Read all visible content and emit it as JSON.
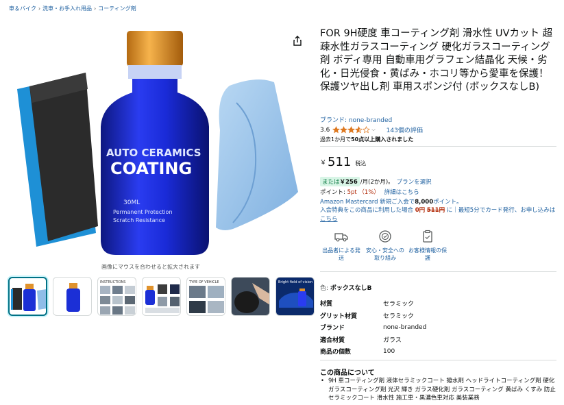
{
  "breadcrumb": [
    "車＆バイク",
    "洗車・お手入れ用品",
    "コーティング剤"
  ],
  "gallery": {
    "bottle_label": [
      "AUTO CERAMICS",
      "COATING",
      "30ML",
      "Permanent Protection",
      "Scratch Resistance"
    ],
    "hover_note": "画像にマウスを合わせると拡大されます",
    "thumb_text": {
      "instructions": "INSTRUCTIONS",
      "type_of_vehicle": "TYPE OF VEHICLE",
      "bright_field": "Bright field of vision"
    }
  },
  "product": {
    "title": "FOR 9H硬度 車コーティング剤 滑水性 UVカット 超疎水性ガラスコーティング 硬化ガラスコーティング剤 ボディ専用 自動車用グラフェン結晶化 天候・劣化・日光侵食・黄ばみ・ホコリ等から愛車を保護！ 保護ツヤ出し剤 車用スポンジ付 (ボックスなしB)",
    "brand": "ブランド: none-branded",
    "rating": "3.6",
    "rating_value": 3.6,
    "review_count": "143個の評価",
    "bought_prefix": "過去1か月で",
    "bought_bold": "50点以上購入されました"
  },
  "price": {
    "currency": "￥",
    "amount": "511",
    "tax": "税込"
  },
  "installment": {
    "prefix": "または",
    "amount": "￥256",
    "rest": "/月(2か月)。",
    "plan_link": "プランを選択"
  },
  "points": {
    "label": "ポイント: ",
    "value": "5pt （1%）",
    "detail": "詳細はこちら"
  },
  "card": {
    "line1_prefix": "Amazon Mastercard 新規ご入会で",
    "line1_bold": "8,000",
    "line1_suffix": "ポイント。",
    "line2_prefix": "入会特典をこの商品に利用した場合",
    "zero": "0円",
    "strike": "511円",
    "line2_suffix": "に｜最短5分でカード発行、お申し込みは",
    "link": "こちら"
  },
  "features": [
    {
      "label": "出品者による発送",
      "icon": "truck-icon"
    },
    {
      "label": "安心・安全への取り組み",
      "icon": "safety-badge-icon"
    },
    {
      "label": "お客様情報の保護",
      "icon": "clipboard-lock-icon"
    }
  ],
  "color": {
    "label": "色: ",
    "value": "ボックスなしB"
  },
  "specs": [
    {
      "key": "材質",
      "value": "セラミック"
    },
    {
      "key": "グリット材質",
      "value": "セラミック"
    },
    {
      "key": "ブランド",
      "value": "none-branded"
    },
    {
      "key": "適合材質",
      "value": "ガラス"
    },
    {
      "key": "商品の個数",
      "value": "100"
    }
  ],
  "about": {
    "heading": "この商品について",
    "bullets": [
      "9H 車コーティング剤 液体セラミックコート 撥水剤 ヘッドライトコーティング剤 硬化ガラスコーティング剤 光沢 輝き ガラス硬化剤 ガラスコーティング 黄ばみ くすみ 防止 セラミックコート 滑水性 施工車・黒濃色車対応 美装業務"
    ]
  },
  "colors": {
    "link": "#2162a1",
    "star": "#de7921",
    "price_red": "#b12704",
    "selected_border": "#007185",
    "bottle_blue": "#1b2fd6",
    "cap_gold": "#e0922c",
    "cloth_blue": "#8fbde8",
    "sponge_blue": "#1e90d6"
  }
}
